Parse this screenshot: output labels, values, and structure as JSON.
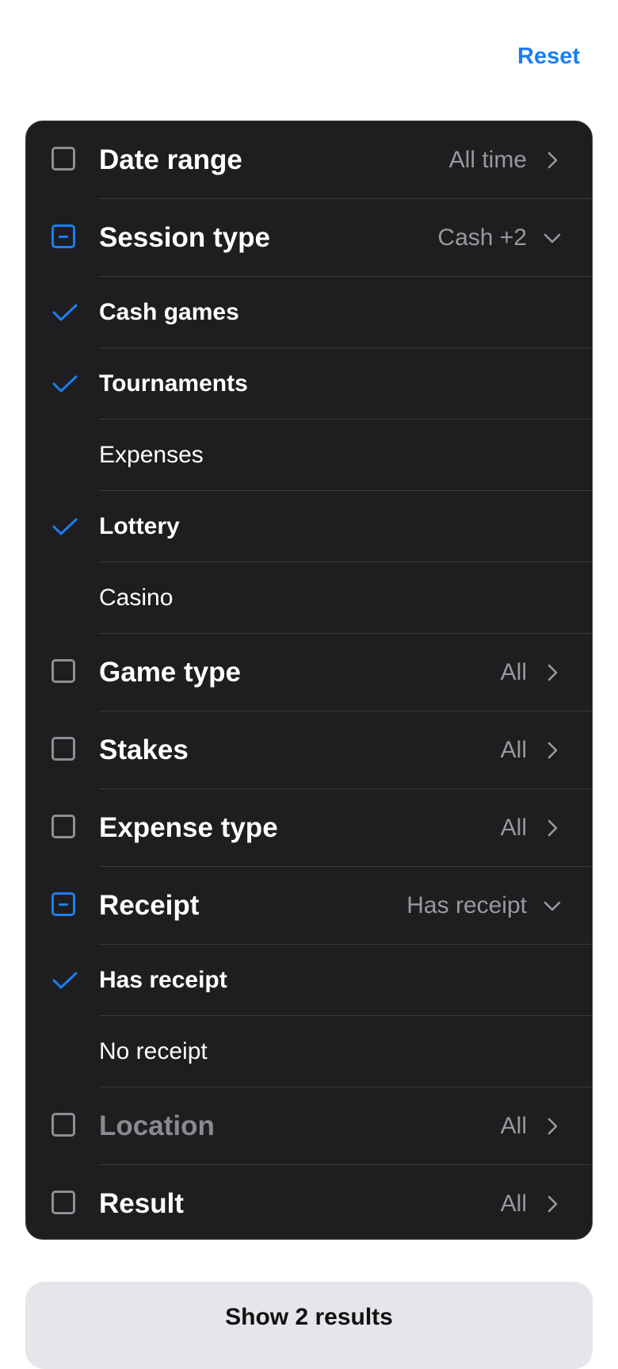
{
  "header": {
    "reset_label": "Reset"
  },
  "colors": {
    "accent": "#1a7ef2",
    "panel_bg": "#1e1e20",
    "divider": "#3a3a3c",
    "muted": "#98989d"
  },
  "filters": {
    "date_range": {
      "label": "Date range",
      "value": "All time",
      "state": "unchecked",
      "chevron": "chevron-right-icon"
    },
    "session_type": {
      "label": "Session type",
      "value": "Cash +2",
      "state": "partial",
      "chevron": "chevron-down-icon",
      "options": [
        {
          "label": "Cash games",
          "checked": true
        },
        {
          "label": "Tournaments",
          "checked": true
        },
        {
          "label": "Expenses",
          "checked": false
        },
        {
          "label": "Lottery",
          "checked": true
        },
        {
          "label": "Casino",
          "checked": false
        }
      ]
    },
    "game_type": {
      "label": "Game type",
      "value": "All",
      "state": "unchecked",
      "chevron": "chevron-right-icon"
    },
    "stakes": {
      "label": "Stakes",
      "value": "All",
      "state": "unchecked",
      "chevron": "chevron-right-icon"
    },
    "expense_type": {
      "label": "Expense type",
      "value": "All",
      "state": "unchecked",
      "chevron": "chevron-right-icon"
    },
    "receipt": {
      "label": "Receipt",
      "value": "Has receipt",
      "state": "partial",
      "chevron": "chevron-down-icon",
      "options": [
        {
          "label": "Has receipt",
          "checked": true
        },
        {
          "label": "No receipt",
          "checked": false
        }
      ]
    },
    "location": {
      "label": "Location",
      "value": "All",
      "state": "unchecked",
      "disabled": true,
      "chevron": "chevron-right-icon"
    },
    "result": {
      "label": "Result",
      "value": "All",
      "state": "unchecked",
      "chevron": "chevron-right-icon"
    }
  },
  "footer": {
    "show_results_label": "Show 2 results"
  }
}
